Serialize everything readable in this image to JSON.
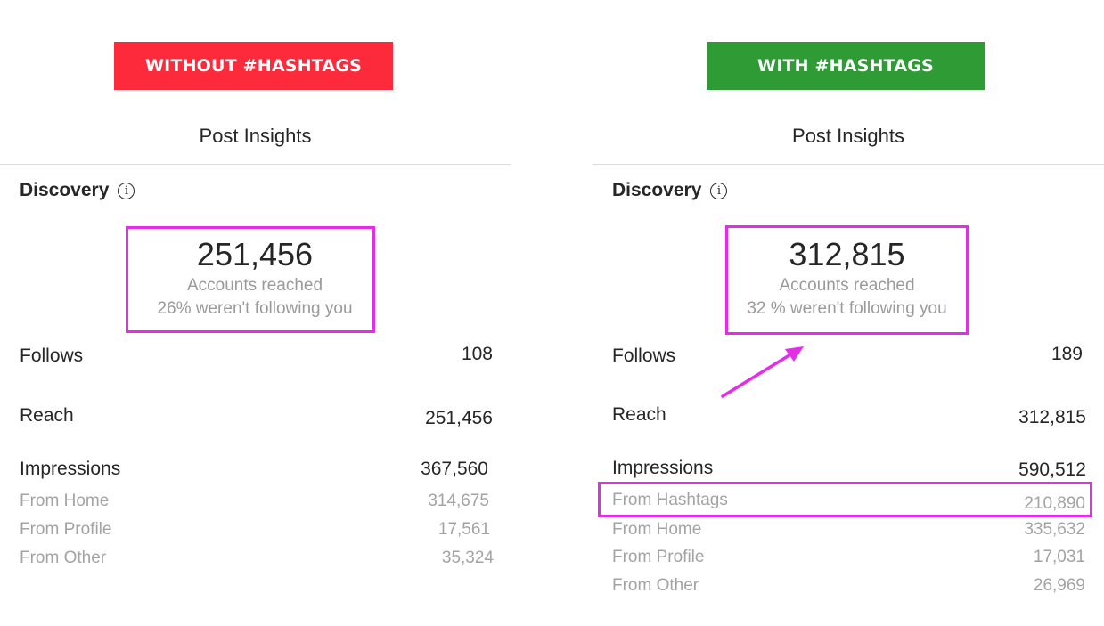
{
  "colors": {
    "without_badge": "#fd2a3b",
    "with_badge": "#2e9b35",
    "highlight": "#e32de8"
  },
  "panels": [
    {
      "badge": "WITHOUT #HASHTAGS",
      "title": "Post Insights",
      "section": "Discovery",
      "section_icon": "info-icon",
      "accounts_reached": "251,456",
      "accounts_reached_label": "Accounts reached",
      "not_following": "26% weren't following you",
      "follows_label": "Follows",
      "follows": "108",
      "reach_label": "Reach",
      "reach": "251,456",
      "impressions_label": "Impressions",
      "impressions": "367,560",
      "breakdown": [
        {
          "label": "From Home",
          "value": "314,675"
        },
        {
          "label": "From Profile",
          "value": "17,561"
        },
        {
          "label": "From Other",
          "value": "35,324"
        }
      ]
    },
    {
      "badge": "WITH #HASHTAGS",
      "title": "Post Insights",
      "section": "Discovery",
      "section_icon": "info-icon",
      "accounts_reached": "312,815",
      "accounts_reached_label": "Accounts reached",
      "not_following": "32 % weren't following you",
      "follows_label": "Follows",
      "follows": "189",
      "reach_label": "Reach",
      "reach": "312,815",
      "impressions_label": "Impressions",
      "impressions": "590,512",
      "breakdown": [
        {
          "label": "From Hashtags",
          "value": "210,890"
        },
        {
          "label": "From Home",
          "value": "335,632"
        },
        {
          "label": "From Profile",
          "value": "17,031"
        },
        {
          "label": "From Other",
          "value": "26,969"
        }
      ]
    }
  ]
}
